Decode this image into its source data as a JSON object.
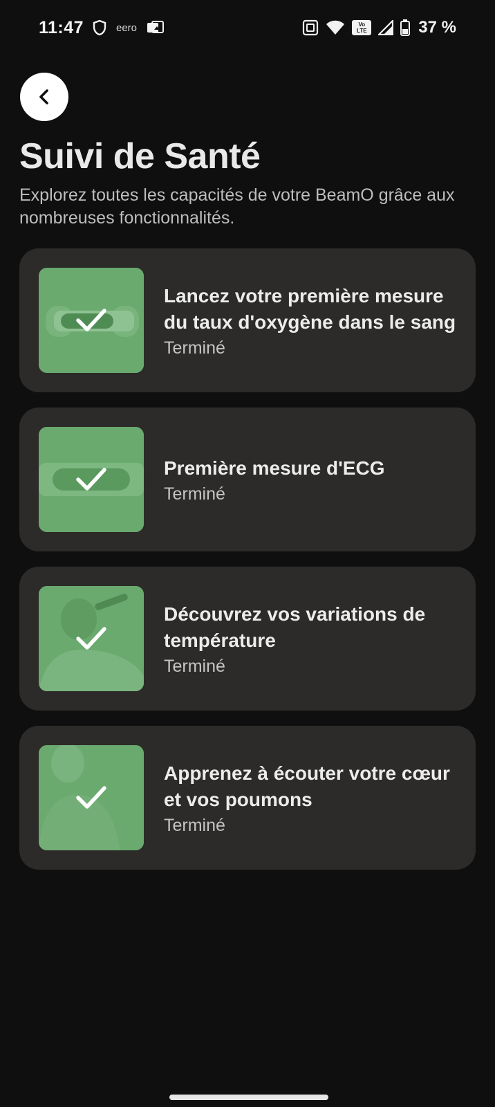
{
  "status_bar": {
    "time": "11:47",
    "carrier_label": "eero",
    "battery": "37 %",
    "volte_label": "Vo\nLTE"
  },
  "header": {
    "title": "Suivi de Santé",
    "subtitle": "Explorez toutes les capacités de votre BeamO grâce aux nombreuses fonctionnalités."
  },
  "cards": [
    {
      "title": "Lancez votre première mesure du taux d'oxygène dans le sang",
      "status": "Terminé"
    },
    {
      "title": "Première mesure d'ECG",
      "status": "Terminé"
    },
    {
      "title": "Découvrez vos variations de température",
      "status": "Terminé"
    },
    {
      "title": "Apprenez à écouter votre cœur et vos poumons",
      "status": "Terminé"
    }
  ],
  "colors": {
    "background": "#0f0f0f",
    "card": "#2c2b29",
    "thumb_green": "#6aaa6e"
  }
}
